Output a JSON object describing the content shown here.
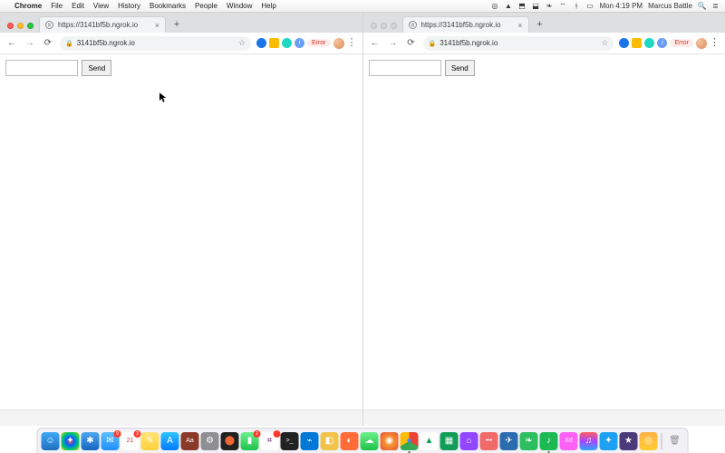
{
  "menubar": {
    "app": "Chrome",
    "items": [
      "File",
      "Edit",
      "View",
      "History",
      "Bookmarks",
      "People",
      "Window",
      "Help"
    ],
    "battery": "",
    "clock": "Mon 4:19 PM",
    "user": "Marcus Battle"
  },
  "windows": [
    {
      "focused": true,
      "tab": {
        "title": "https://3141bf5b.ngrok.io"
      },
      "address": "3141bf5b.ngrok.io",
      "error_label": "Error",
      "page": {
        "send_label": "Send",
        "input_value": ""
      }
    },
    {
      "focused": false,
      "tab": {
        "title": "https://3141bf5b.ngrok.io"
      },
      "address": "3141bf5b.ngrok.io",
      "error_label": "Error",
      "page": {
        "send_label": "Send",
        "input_value": ""
      }
    }
  ],
  "dock": {
    "items": [
      {
        "name": "finder",
        "bg": "linear-gradient(#3fa9f5,#1f6fbf)",
        "glyph": "☺"
      },
      {
        "name": "launchpad",
        "bg": "radial-gradient(circle,#f44,#06f,#0c6,#fc0)",
        "glyph": "✦"
      },
      {
        "name": "safari",
        "bg": "linear-gradient(#4ea7f0,#1665c0)",
        "glyph": "✱"
      },
      {
        "name": "mail",
        "bg": "linear-gradient(#5ec0ff,#1f8fff)",
        "glyph": "✉",
        "badge": "9"
      },
      {
        "name": "calendar",
        "bg": "#fff",
        "glyph": "21",
        "text": "#d33",
        "badge": "3"
      },
      {
        "name": "notes",
        "bg": "linear-gradient(#ffe37a,#ffd23a)",
        "glyph": "✎"
      },
      {
        "name": "appstore",
        "bg": "linear-gradient(#31c3ff,#017aff)",
        "glyph": "A"
      },
      {
        "name": "dictionary",
        "bg": "#8b3a2a",
        "glyph": "Aa"
      },
      {
        "name": "preferences",
        "bg": "#8e8e93",
        "glyph": "⚙"
      },
      {
        "name": "activity",
        "bg": "#222",
        "glyph": "⬤",
        "text": "#e63"
      },
      {
        "name": "facetime",
        "bg": "linear-gradient(#6df08c,#1ec24a)",
        "glyph": "▮",
        "badge": "2"
      },
      {
        "name": "slack",
        "bg": "#fff",
        "glyph": "⌗",
        "text": "#611f69",
        "badge": ""
      },
      {
        "name": "terminal",
        "bg": "#222",
        "glyph": ">_"
      },
      {
        "name": "vscode",
        "bg": "#0078d7",
        "glyph": "⌁"
      },
      {
        "name": "sequel",
        "bg": "#f2c34a",
        "glyph": "◧"
      },
      {
        "name": "postman",
        "bg": "#ff6c37",
        "glyph": "◐"
      },
      {
        "name": "messages",
        "bg": "linear-gradient(#6df08c,#1ec24a)",
        "glyph": "☁"
      },
      {
        "name": "firefox",
        "bg": "radial-gradient(circle,#ffb23e,#e5522c)",
        "glyph": "◉"
      },
      {
        "name": "chrome",
        "bg": "conic-gradient(#ea4335 0 120deg,#34a853 120deg 240deg,#fbbc05 240deg 360deg)",
        "glyph": "●",
        "text": "#4285f4",
        "running": true
      },
      {
        "name": "drive",
        "bg": "#fff",
        "glyph": "▲",
        "text": "#0f9d58"
      },
      {
        "name": "sheets",
        "bg": "#0f9d58",
        "glyph": "▦"
      },
      {
        "name": "twitch",
        "bg": "#9146ff",
        "glyph": "⌂"
      },
      {
        "name": "asana",
        "bg": "#f06a6a",
        "glyph": "•••"
      },
      {
        "name": "spark",
        "bg": "#2b6cb0",
        "glyph": "✈"
      },
      {
        "name": "evernote",
        "bg": "#2dbe60",
        "glyph": "❧"
      },
      {
        "name": "spotify",
        "bg": "#1db954",
        "glyph": "♪",
        "running": true
      },
      {
        "name": "xd",
        "bg": "#ff61f6",
        "glyph": "Xd"
      },
      {
        "name": "itunes",
        "bg": "linear-gradient(#ff5e62,#a645ff,#2fa8ff)",
        "glyph": "♫"
      },
      {
        "name": "twitter",
        "bg": "#1da1f2",
        "glyph": "✦"
      },
      {
        "name": "imovie",
        "bg": "#4a3a7a",
        "glyph": "★"
      },
      {
        "name": "photobooth",
        "bg": "linear-gradient(#ffb347,#ffcc33)",
        "glyph": "◎"
      }
    ],
    "trash": {
      "name": "trash",
      "bg": "transparent",
      "glyph": "🗑",
      "text": "#8e8e93"
    }
  }
}
